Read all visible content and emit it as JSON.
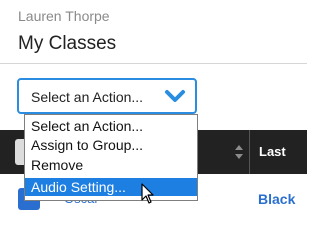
{
  "header": {
    "user_name": "Lauren Thorpe",
    "title": "My Classes"
  },
  "action_select": {
    "selected": "Select an Action...",
    "icon": "chevron-down-icon",
    "accent_color": "#2a8de0"
  },
  "dropdown": {
    "options": [
      "Select an Action...",
      "Assign to Group...",
      "Remove",
      "Audio Setting..."
    ],
    "highlighted_index": 3,
    "highlight_color": "#1e7fe3"
  },
  "table": {
    "header_background": "#222222",
    "columns": {
      "last_name": "Last"
    },
    "rows": [
      {
        "first_name": "Oscar",
        "last_name": "Black"
      }
    ]
  },
  "cursor": {
    "icon": "mouse-pointer-icon"
  }
}
